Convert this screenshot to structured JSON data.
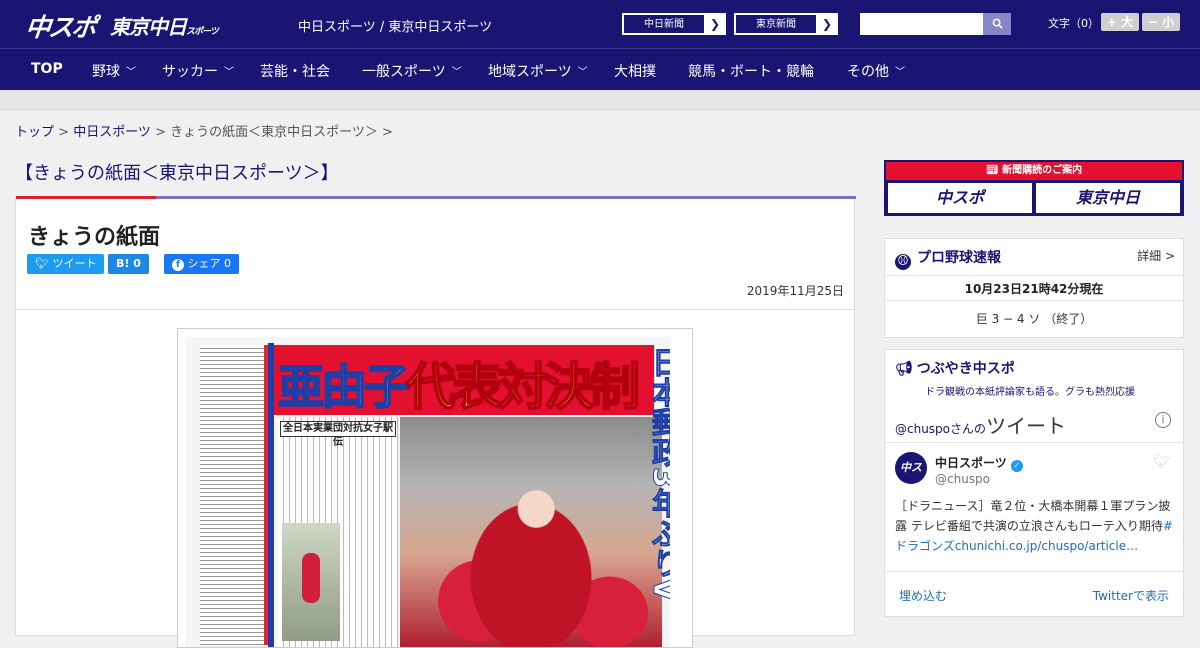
{
  "header": {
    "logo_main": "中スポ",
    "logo_tokyo": "東京中日",
    "logo_tokyo_small": "スポーツ",
    "site_name": "中日スポーツ / 東京中日スポーツ",
    "chunichi_btn": "中日新聞",
    "tokyo_btn": "東京新聞",
    "search_placeholder": "",
    "font_label": "文字（0）",
    "font_bigger": "+ 大",
    "font_smaller": "− 小"
  },
  "nav": {
    "items": [
      {
        "label": "TOP",
        "dropdown": false
      },
      {
        "label": "野球",
        "dropdown": true
      },
      {
        "label": "サッカー",
        "dropdown": true
      },
      {
        "label": "芸能・社会",
        "dropdown": false
      },
      {
        "label": "一般スポーツ",
        "dropdown": true
      },
      {
        "label": "地域スポーツ",
        "dropdown": true
      },
      {
        "label": "大相撲",
        "dropdown": false
      },
      {
        "label": "競馬・ボート・競輪",
        "dropdown": false
      },
      {
        "label": "その他",
        "dropdown": true
      }
    ]
  },
  "breadcrumb": {
    "top": "トップ",
    "sep1": " > ",
    "chunichi": "中日スポーツ",
    "sep2": " > ",
    "current": "きょうの紙面＜東京中日スポーツ＞ >"
  },
  "page_heading": "【きょうの紙面＜東京中日スポーツ＞】",
  "article": {
    "title": "きょうの紙面",
    "share_tweet": "ツイート",
    "share_hatena": "B! 0",
    "share_fb": "シェア 0",
    "date": "2019年11月25日",
    "paper": {
      "headline_name": "亜由子",
      "headline_main": "代表対決制す",
      "vertical": "日本郵政3年ぶりV",
      "subhead": "全日本実業団対抗女子駅伝"
    }
  },
  "sidebar": {
    "ad_top": "新聞購読のご案内",
    "ad_logo_left": "中スポ",
    "ad_logo_right": "東京中日",
    "baseball": {
      "title": "プロ野球速報",
      "more": "詳細 >",
      "timestamp": "10月23日21時42分現在",
      "score": "巨 3 − 4 ソ （終了）"
    },
    "tweets": {
      "title": "つぶやき中スポ",
      "subtitle": "ドラ観戦の本紙評論家も語る。グラも熱烈応援",
      "at": "@chuspo",
      "san_no": "さんの",
      "tweet_word": "ツイート",
      "info": "i",
      "avatar": "中スポ",
      "name": "中日スポーツ",
      "handle": "@chuspo",
      "text": "［ドラニュース］竜２位・大橋本開幕１軍プラン披露 テレビ番組で共演の立浪さんもローテ入り期待",
      "link": "#ドラゴンズchunichi.co.jp/chuspo/article…",
      "embed": "埋め込む",
      "view_on_twitter": "Twitterで表示"
    }
  },
  "colors": {
    "brand_navy": "#1a1473",
    "brand_red": "#e4102f",
    "twitter_blue": "#1d9bf0",
    "accent_purple": "#7b72b8"
  }
}
